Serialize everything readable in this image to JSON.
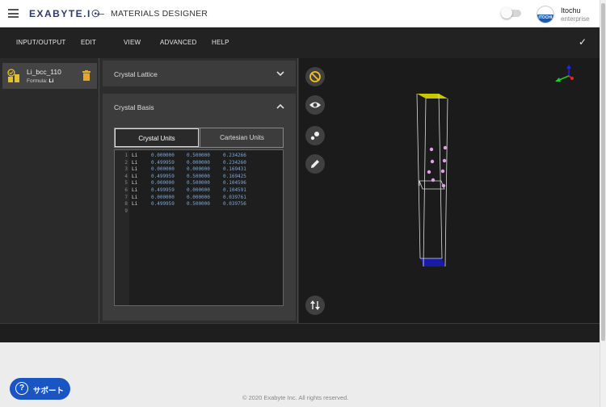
{
  "header": {
    "logo": "EXABYTE.I☉",
    "title": "MATERIALS DESIGNER",
    "user_name": "Itochu",
    "user_org": "enterprise",
    "avatar_text": "ITOCHU"
  },
  "menu": {
    "items": [
      "INPUT/OUTPUT",
      "EDIT",
      "VIEW",
      "ADVANCED",
      "HELP"
    ]
  },
  "material": {
    "name": "Li_bcc_110",
    "formula_label": "Formula:",
    "formula": "Li"
  },
  "panels": {
    "lattice_title": "Crystal Lattice",
    "basis_title": "Crystal Basis"
  },
  "tabs": {
    "crystal": "Crystal Units",
    "cartesian": "Cartesian Units"
  },
  "basis_rows": [
    {
      "n": "1",
      "el": "Li",
      "x": "0.000000",
      "y": "0.500000",
      "z": "0.234266"
    },
    {
      "n": "2",
      "el": "Li",
      "x": "0.499959",
      "y": "0.000000",
      "z": "0.234260"
    },
    {
      "n": "3",
      "el": "Li",
      "x": "0.000000",
      "y": "0.000000",
      "z": "0.169431"
    },
    {
      "n": "4",
      "el": "Li",
      "x": "0.499959",
      "y": "0.500000",
      "z": "0.169425"
    },
    {
      "n": "5",
      "el": "Li",
      "x": "0.000000",
      "y": "0.500000",
      "z": "0.104596"
    },
    {
      "n": "6",
      "el": "Li",
      "x": "0.499959",
      "y": "0.000000",
      "z": "0.104591"
    },
    {
      "n": "7",
      "el": "Li",
      "x": "0.000000",
      "y": "0.000000",
      "z": "0.039761"
    },
    {
      "n": "8",
      "el": "Li",
      "x": "0.499959",
      "y": "0.500000",
      "z": "0.039756"
    },
    {
      "n": "9",
      "el": "",
      "x": "",
      "y": "",
      "z": ""
    }
  ],
  "support": {
    "label": "サポート"
  },
  "footer": "© 2020 Exabyte Inc. All rights reserved.",
  "colors": {
    "accent": "#1a55c4",
    "atom": "#e89cf0",
    "cell_top": "#c8c800",
    "cell_bottom": "#1a1aa8"
  }
}
